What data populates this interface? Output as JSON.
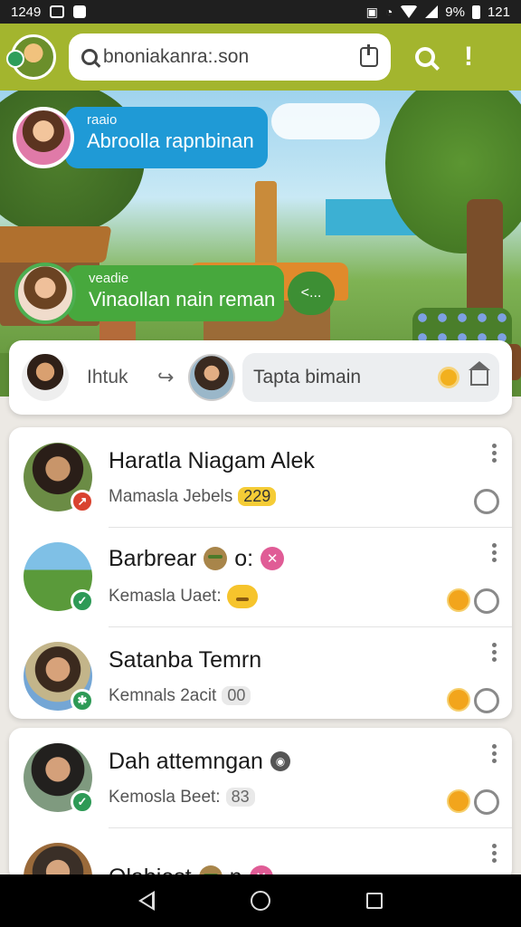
{
  "status_bar": {
    "time": "1249",
    "right_text": "9%",
    "right_time": "121"
  },
  "app_bar": {
    "url": "bnoniakanra:.son",
    "alert_icon": "!"
  },
  "hero": {
    "bubble1": {
      "small": "raaio",
      "large": "Abroolla rapnbinan"
    },
    "bubble2": {
      "small": "veadie",
      "large": "Vinaollan nain reman",
      "pill": "<..."
    }
  },
  "compose": {
    "author": "Ihtuk",
    "redo": "↪",
    "input_text": "Tapta bimain"
  },
  "chats": [
    {
      "name": "Haratla Niagam Alek",
      "preview": "Mamasla Jebels",
      "count": "229",
      "status": "red"
    },
    {
      "name": "Barbrear",
      "name_suffix": "o:",
      "preview": "Kemasla Uaet:",
      "status": "green"
    },
    {
      "name": "Satanba Temrn",
      "preview": "Kemnals 2acit",
      "count": "00",
      "status": "green"
    },
    {
      "name": "Dah attemngan",
      "preview": "Kemosla Beet:",
      "count": "83",
      "status": "green"
    },
    {
      "name": "Olabiest",
      "name_suffix": "n",
      "status": "none"
    }
  ],
  "colors": {
    "app_bar": "#a3b52e",
    "bubble_blue": "#1f9ad6",
    "bubble_green": "#47a83d"
  }
}
